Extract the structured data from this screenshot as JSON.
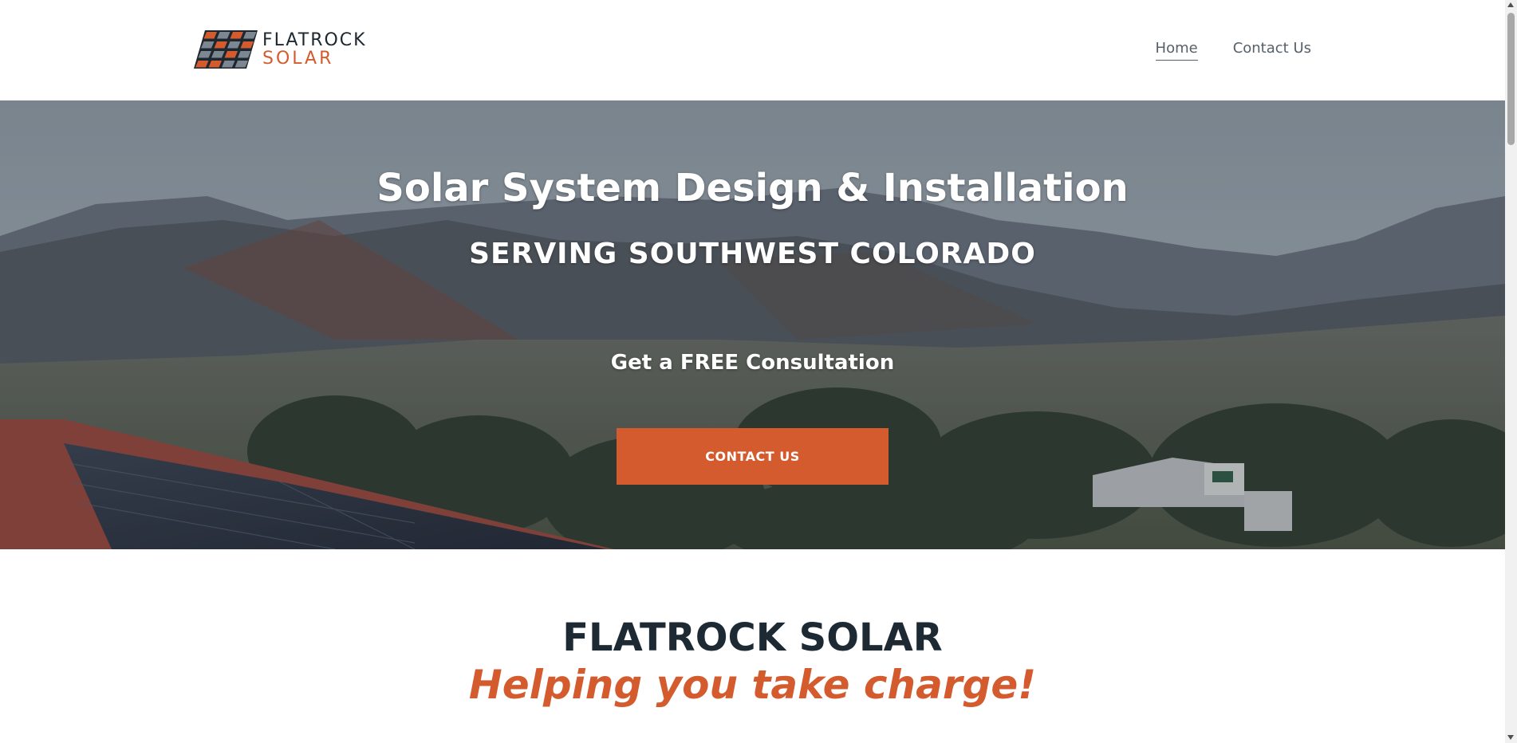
{
  "header": {
    "logo": {
      "line1": "FLATROCK",
      "line2": "SOLAR",
      "brand_color": "#d45b2e",
      "dark_color": "#1d2730"
    },
    "nav": [
      {
        "label": "Home",
        "active": true
      },
      {
        "label": "Contact Us",
        "active": false
      }
    ]
  },
  "hero": {
    "title": "Solar System Design & Installation",
    "subtitle": "SERVING SOUTHWEST COLORADO",
    "cta_text": "Get a FREE Consultation",
    "button_label": "CONTACT US",
    "button_color": "#d45b2e"
  },
  "intro": {
    "title": "FLATROCK SOLAR",
    "tagline": "Helping you take charge!"
  },
  "colors": {
    "accent": "#d45b2e",
    "heading": "#1d2a33",
    "nav_text": "#55606a"
  }
}
